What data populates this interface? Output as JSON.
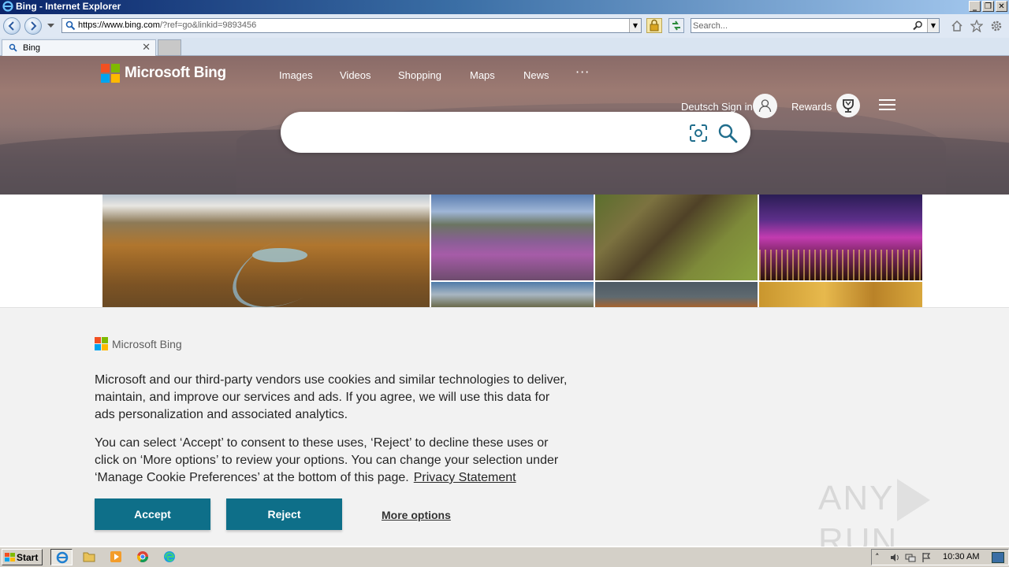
{
  "window": {
    "title": "Bing - Internet Explorer",
    "controls": [
      "_",
      "❐",
      "✕"
    ]
  },
  "ie": {
    "address_host": "https://www.bing.com",
    "address_rest": "/?ref=go&linkid=9893456",
    "search_placeholder": "Search...",
    "tab_title": "Bing",
    "tab_close": "✕"
  },
  "bing": {
    "logo_text": "Microsoft Bing",
    "nav": [
      "Images",
      "Videos",
      "Shopping",
      "Maps",
      "News"
    ],
    "more_dots": "···",
    "language_link": "Deutsch",
    "signin_label": "Sign in",
    "rewards_label": "Rewards",
    "search_value": ""
  },
  "cookie": {
    "logo_text": "Microsoft Bing",
    "paragraph1": "Microsoft and our third-party vendors use cookies and similar technologies to deliver, maintain, and improve our services and ads. If you agree, we will use this data for ads personalization and associated analytics.",
    "paragraph2": "You can select ‘Accept’ to consent to these uses, ‘Reject’ to decline these uses or click on ‘More options’ to review your options. You can change your selection under ‘Manage Cookie Preferences’ at the bottom of this page.",
    "privacy_link": "Privacy Statement",
    "accept_label": "Accept",
    "reject_label": "Reject",
    "more_options_label": "More options",
    "button_color": "#0e6f89"
  },
  "watermark": {
    "left": "ANY",
    "right": "RUN"
  },
  "taskbar": {
    "start_label": "Start",
    "clock": "10:30 AM",
    "pinned": [
      "internet-explorer-icon",
      "folder-icon",
      "media-player-icon",
      "chrome-icon",
      "edge-icon"
    ]
  }
}
